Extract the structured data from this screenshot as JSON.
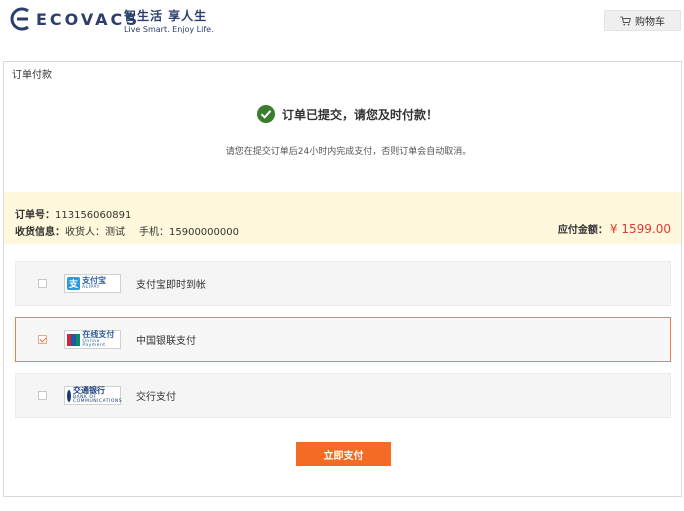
{
  "header": {
    "logo_text": "ECOVACS",
    "slogan_cn": "智生活  享人生",
    "slogan_en": "Live Smart. Enjoy Life.",
    "cart_label": "购物车"
  },
  "panel": {
    "title": "订单付款",
    "success_message": "订单已提交，请您及时付款！",
    "notice": "请您在提交订单后24小时内完成支付，否则订单会自动取消。"
  },
  "order_info": {
    "order_no_label": "订单号：",
    "order_no": "113156060891",
    "receiver_label": "收货信息：",
    "receiver": "收货人：测试",
    "phone": "手机：15900000000",
    "amount_label": "应付金额：",
    "amount": "¥ 1599.00"
  },
  "payment_options": [
    {
      "logo_main": "支付宝",
      "logo_sub": "ALIPAY",
      "label": "支付宝即时到帐",
      "checked": false
    },
    {
      "logo_main": "在线支付",
      "logo_sub": "Online Payment",
      "label": "中国银联支付",
      "checked": true
    },
    {
      "logo_main": "交通银行",
      "logo_sub": "BANK OF COMMUNICATIONS",
      "label": "交行支付",
      "checked": false
    }
  ],
  "submit_label": "立即支付",
  "colors": {
    "accent": "#f36b24",
    "amount": "#e23a32",
    "success": "#3a7d2c",
    "info_bg": "#fff8dc"
  },
  "icons": {
    "logo": "ecovacs-logo-icon",
    "cart": "cart-icon",
    "success": "check-circle-icon"
  }
}
